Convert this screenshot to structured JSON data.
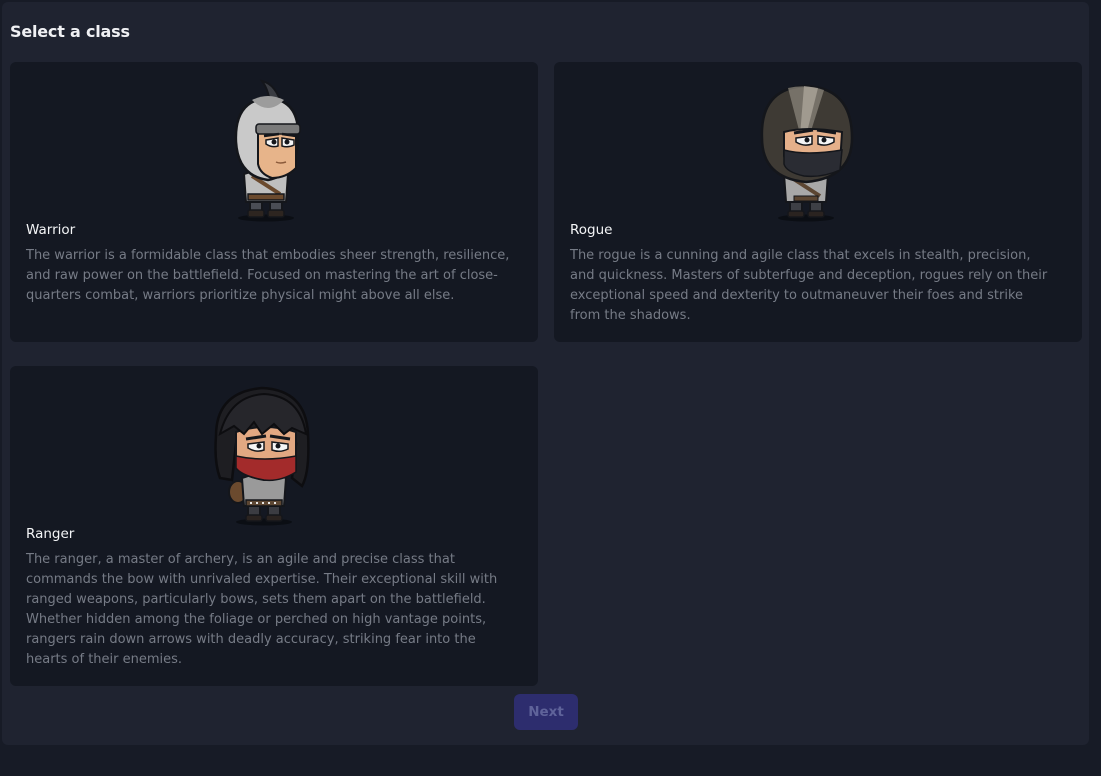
{
  "page": {
    "title": "Select a class"
  },
  "classes": [
    {
      "name": "Warrior",
      "icon": "warrior-helmet-character-icon",
      "description": "The warrior is a formidable class that embodies sheer strength, resilience, and raw power on the battlefield. Focused on mastering the art of close-quarters combat, warriors prioritize physical might above all else."
    },
    {
      "name": "Rogue",
      "icon": "rogue-hooded-character-icon",
      "description": "The rogue is a cunning and agile class that excels in stealth, precision, and quickness. Masters of subterfuge and deception, rogues rely on their exceptional speed and dexterity to outmaneuver their foes and strike from the shadows."
    },
    {
      "name": "Ranger",
      "icon": "ranger-masked-character-icon",
      "description": "The ranger, a master of archery, is an agile and precise class that commands the bow with unrivaled expertise. Their exceptional skill with ranged weapons, particularly bows, sets them apart on the battlefield. Whether hidden among the foliage or perched on high vantage points, rangers rain down arrows with deadly accuracy, striking fear into the hearts of their enemies."
    }
  ],
  "actions": {
    "next_label": "Next",
    "next_disabled": true
  },
  "colors": {
    "page_background": "#171b26",
    "panel_background": "#1f2330",
    "card_background": "#141822",
    "next_button_background": "#2d2d6e",
    "next_button_text": "#5f639a"
  }
}
